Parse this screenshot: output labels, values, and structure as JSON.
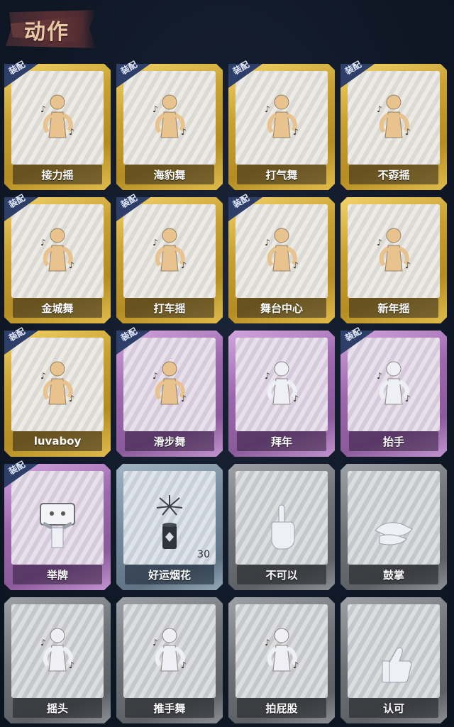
{
  "header": {
    "title": "动作"
  },
  "equipped_label": "装配",
  "colors": {
    "gold": "#c9a233",
    "purple": "#9d68ad",
    "blue": "#72889a",
    "gray": "#6e7176",
    "badge": "#2d3e68",
    "figure_gold": "#e8c38e",
    "figure_white": "#eef0f6"
  },
  "cards": [
    {
      "label": "接力摇",
      "tier": "gold",
      "equipped": true,
      "icon": "dance-figure-icon"
    },
    {
      "label": "海豹舞",
      "tier": "gold",
      "equipped": true,
      "icon": "dance-figure-icon"
    },
    {
      "label": "打气舞",
      "tier": "gold",
      "equipped": true,
      "icon": "dance-figure-icon"
    },
    {
      "label": "不孬摇",
      "tier": "gold",
      "equipped": true,
      "icon": "dance-figure-icon"
    },
    {
      "label": "金城舞",
      "tier": "gold",
      "equipped": true,
      "icon": "dance-figure-icon"
    },
    {
      "label": "打车摇",
      "tier": "gold",
      "equipped": true,
      "icon": "dance-figure-icon"
    },
    {
      "label": "舞台中心",
      "tier": "gold",
      "equipped": true,
      "icon": "dance-figure-icon"
    },
    {
      "label": "新年摇",
      "tier": "gold",
      "equipped": false,
      "icon": "dance-figure-icon"
    },
    {
      "label": "luvaboy",
      "tier": "gold",
      "equipped": true,
      "icon": "dance-figure-icon"
    },
    {
      "label": "滑步舞",
      "tier": "purple",
      "equipped": true,
      "icon": "dance-figure-icon"
    },
    {
      "label": "拜年",
      "tier": "purple",
      "equipped": false,
      "icon": "greeting-figure-icon"
    },
    {
      "label": "抬手",
      "tier": "purple",
      "equipped": true,
      "icon": "raise-hand-figure-icon"
    },
    {
      "label": "举牌",
      "tier": "purple",
      "equipped": true,
      "icon": "hold-sign-figure-icon"
    },
    {
      "label": "好运烟花",
      "tier": "blue",
      "equipped": false,
      "icon": "firework-icon",
      "count": "30"
    },
    {
      "label": "不可以",
      "tier": "gray",
      "equipped": false,
      "icon": "finger-wag-icon"
    },
    {
      "label": "鼓掌",
      "tier": "gray",
      "equipped": false,
      "icon": "clap-hands-icon"
    },
    {
      "label": "摇头",
      "tier": "gray",
      "equipped": false,
      "icon": "shake-head-figure-icon"
    },
    {
      "label": "推手舞",
      "tier": "gray",
      "equipped": false,
      "icon": "push-hands-figure-icon"
    },
    {
      "label": "拍屁股",
      "tier": "gray",
      "equipped": false,
      "icon": "pat-figure-icon"
    },
    {
      "label": "认可",
      "tier": "gray",
      "equipped": false,
      "icon": "thumbs-up-icon"
    }
  ]
}
